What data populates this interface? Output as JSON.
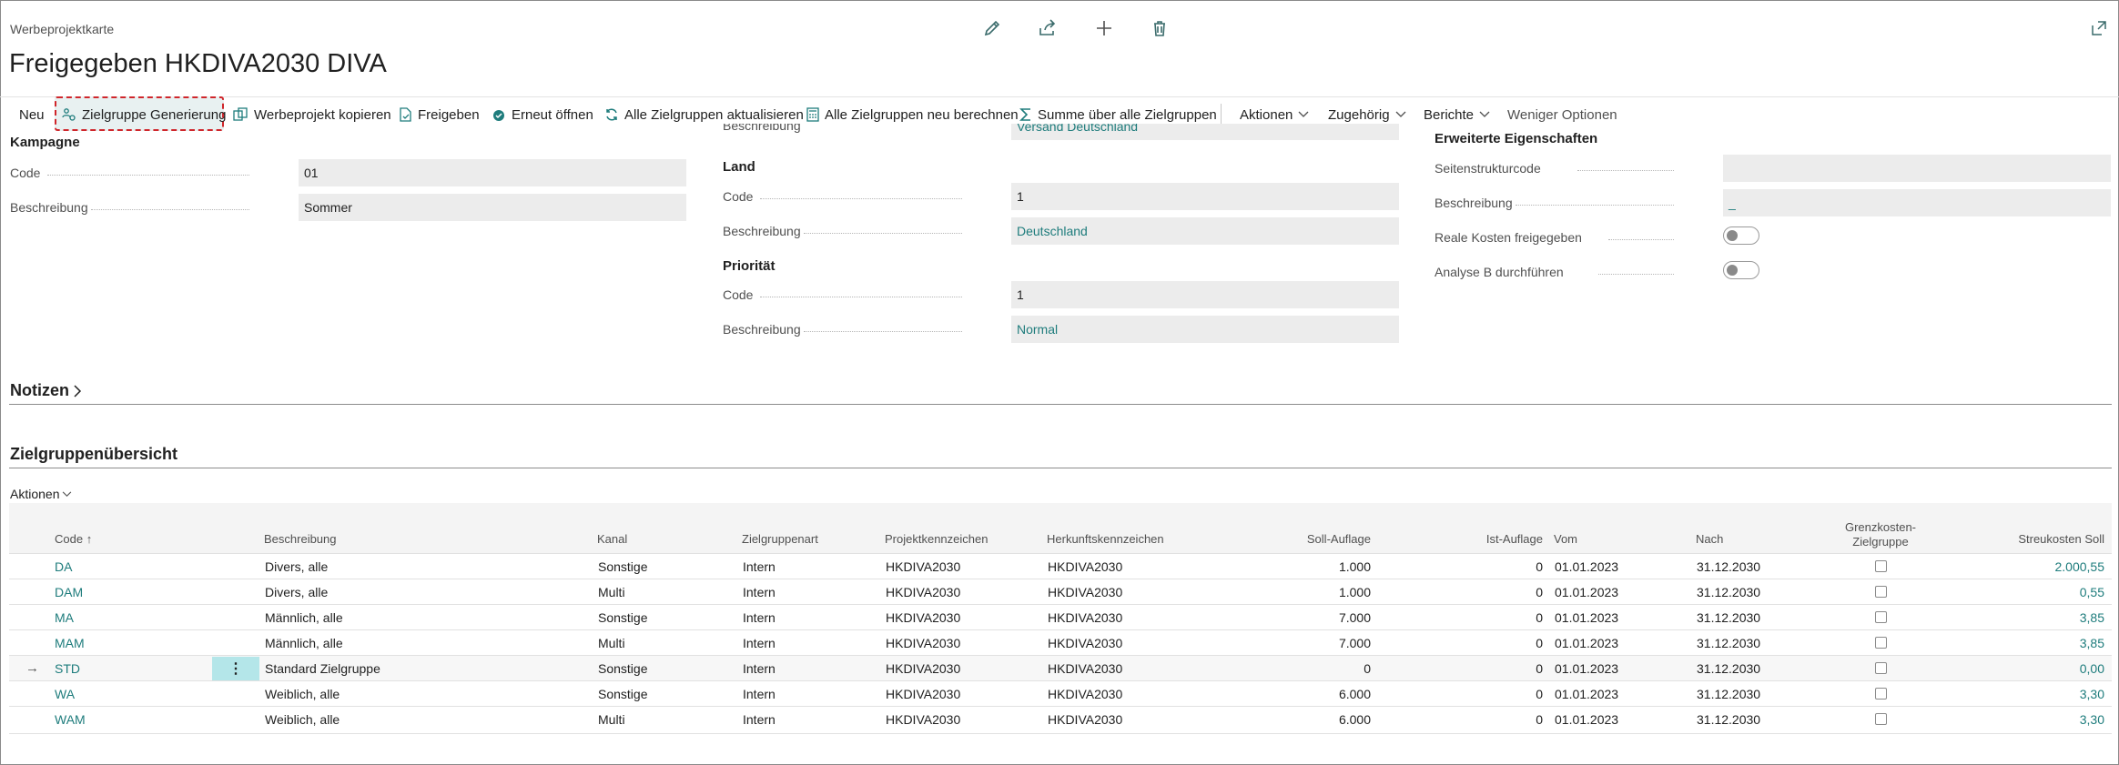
{
  "page": {
    "card_label": "Werbeprojektkarte",
    "title": "Freigegeben HKDIVA2030 DIVA"
  },
  "icons": {
    "edit": "pencil-icon",
    "share": "share-icon",
    "new": "plus-icon",
    "delete": "trash-icon",
    "expand": "expand-icon"
  },
  "action_bar": {
    "new": "Neu",
    "generate": "Zielgruppe Generierung",
    "copy": "Werbeprojekt kopieren",
    "release": "Freigeben",
    "reopen": "Erneut öffnen",
    "refresh_all": "Alle Zielgruppen aktualisieren",
    "recalc_all": "Alle Zielgruppen neu berechnen",
    "sum_all": "Summe über alle Zielgruppen",
    "actions": "Aktionen",
    "related": "Zugehörig",
    "reports": "Berichte",
    "fewer": "Weniger Optionen"
  },
  "col1": {
    "section": "Kampagne",
    "code_label": "Code",
    "code_value": "01",
    "desc_label": "Beschreibung",
    "desc_value": "Sommer"
  },
  "col2": {
    "top_desc_label": "Beschreibung",
    "top_desc_value": "Versand Deutschland",
    "land_section": "Land",
    "land_code_label": "Code",
    "land_code_value": "1",
    "land_desc_label": "Beschreibung",
    "land_desc_value": "Deutschland",
    "prio_section": "Priorität",
    "prio_code_label": "Code",
    "prio_code_value": "1",
    "prio_desc_label": "Beschreibung",
    "prio_desc_value": "Normal"
  },
  "col3": {
    "section": "Erweiterte Eigenschaften",
    "page_struct_label": "Seitenstrukturcode",
    "page_struct_value": "",
    "desc_label": "Beschreibung",
    "desc_value": "_",
    "real_cost_label": "Reale Kosten freigegeben",
    "real_cost_on": false,
    "analysis_label": "Analyse B durchführen",
    "analysis_on": false
  },
  "notes": {
    "title": "Notizen"
  },
  "overview": {
    "title": "Zielgruppenübersicht",
    "actions": "Aktionen",
    "headers": {
      "code": "Code",
      "desc": "Beschreibung",
      "kanal": "Kanal",
      "art": "Zielgruppenart",
      "projekt": "Projektkennzeichen",
      "herkunft": "Herkunftskennzeichen",
      "soll": "Soll-Auflage",
      "ist": "Ist-Auflage",
      "vom": "Vom",
      "nach": "Nach",
      "grenz_1": "Grenzkosten-",
      "grenz_2": "Zielgruppe",
      "streu": "Streukosten Soll"
    },
    "rows": [
      {
        "code": "DA",
        "desc": "Divers, alle",
        "kanal": "Sonstige",
        "art": "Intern",
        "projekt": "HKDIVA2030",
        "herkunft": "HKDIVA2030",
        "soll": "1.000",
        "ist": "0",
        "vom": "01.01.2023",
        "nach": "31.12.2030",
        "grenz": false,
        "streu": "2.000,55"
      },
      {
        "code": "DAM",
        "desc": "Divers, alle",
        "kanal": "Multi",
        "art": "Intern",
        "projekt": "HKDIVA2030",
        "herkunft": "HKDIVA2030",
        "soll": "1.000",
        "ist": "0",
        "vom": "01.01.2023",
        "nach": "31.12.2030",
        "grenz": false,
        "streu": "0,55"
      },
      {
        "code": "MA",
        "desc": "Männlich, alle",
        "kanal": "Sonstige",
        "art": "Intern",
        "projekt": "HKDIVA2030",
        "herkunft": "HKDIVA2030",
        "soll": "7.000",
        "ist": "0",
        "vom": "01.01.2023",
        "nach": "31.12.2030",
        "grenz": false,
        "streu": "3,85"
      },
      {
        "code": "MAM",
        "desc": "Männlich, alle",
        "kanal": "Multi",
        "art": "Intern",
        "projekt": "HKDIVA2030",
        "herkunft": "HKDIVA2030",
        "soll": "7.000",
        "ist": "0",
        "vom": "01.01.2023",
        "nach": "31.12.2030",
        "grenz": false,
        "streu": "3,85"
      },
      {
        "code": "STD",
        "desc": "Standard Zielgruppe",
        "kanal": "Sonstige",
        "art": "Intern",
        "projekt": "HKDIVA2030",
        "herkunft": "HKDIVA2030",
        "soll": "0",
        "ist": "0",
        "vom": "01.01.2023",
        "nach": "31.12.2030",
        "grenz": false,
        "streu": "0,00",
        "selected": true
      },
      {
        "code": "WA",
        "desc": "Weiblich, alle",
        "kanal": "Sonstige",
        "art": "Intern",
        "projekt": "HKDIVA2030",
        "herkunft": "HKDIVA2030",
        "soll": "6.000",
        "ist": "0",
        "vom": "01.01.2023",
        "nach": "31.12.2030",
        "grenz": false,
        "streu": "3,30"
      },
      {
        "code": "WAM",
        "desc": "Weiblich, alle",
        "kanal": "Multi",
        "art": "Intern",
        "projekt": "HKDIVA2030",
        "herkunft": "HKDIVA2030",
        "soll": "6.000",
        "ist": "0",
        "vom": "01.01.2023",
        "nach": "31.12.2030",
        "grenz": false,
        "streu": "3,30"
      }
    ]
  },
  "colors": {
    "accent": "#1e7c7c",
    "highlight_border": "#d0262b",
    "selected_menu": "#b4e6e9"
  }
}
